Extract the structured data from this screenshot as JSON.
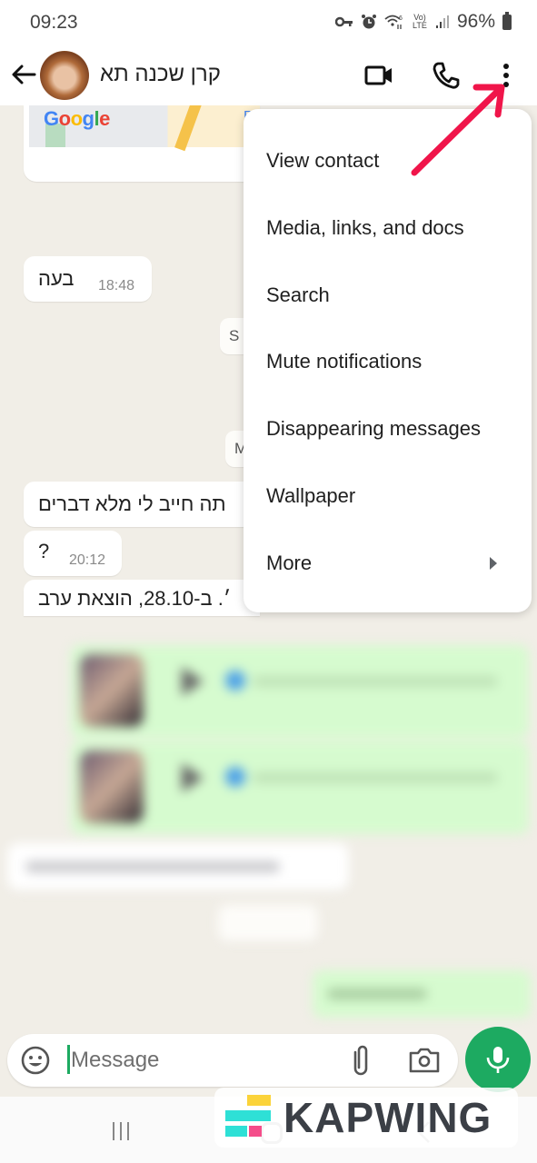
{
  "status_bar": {
    "time": "09:23",
    "battery": "96%",
    "icons": [
      "vpn-key-icon",
      "alarm-icon",
      "wifi6-icon",
      "volte-icon",
      "signal-icon",
      "battery-icon"
    ],
    "volte_label": "Vo) LTE"
  },
  "header": {
    "contact_name": "קרן שכנה תא",
    "icons": [
      "back-arrow-icon",
      "video-call-icon",
      "voice-call-icon",
      "more-options-icon"
    ]
  },
  "chat": {
    "map_logo": "Google",
    "map_label": "P",
    "messages": [
      {
        "direction": "incoming",
        "text": "בעה",
        "time": "18:48"
      },
      {
        "direction": "incoming",
        "text": "תה חייב לי מלא דברים",
        "time": ""
      },
      {
        "direction": "incoming",
        "text": "?",
        "time": "20:12"
      },
      {
        "direction": "incoming",
        "text": "׳. ב-28.10, הוצאת ערב",
        "time": ""
      }
    ],
    "date_chips": [
      "S",
      "M"
    ],
    "blurred_section": true
  },
  "menu": {
    "items": [
      {
        "label": "View contact",
        "has_submenu": false
      },
      {
        "label": "Media, links, and docs",
        "has_submenu": false
      },
      {
        "label": "Search",
        "has_submenu": false
      },
      {
        "label": "Mute notifications",
        "has_submenu": false
      },
      {
        "label": "Disappearing messages",
        "has_submenu": false
      },
      {
        "label": "Wallpaper",
        "has_submenu": false
      },
      {
        "label": "More",
        "has_submenu": true
      }
    ]
  },
  "input": {
    "placeholder": "Message",
    "value": ""
  },
  "watermark": {
    "text": "KAPWING"
  },
  "colors": {
    "accent_green": "#1daa61",
    "annotation_arrow": "#f0154a",
    "chat_background": "#f1eee7",
    "outgoing_bubble": "#d6fbcf"
  }
}
